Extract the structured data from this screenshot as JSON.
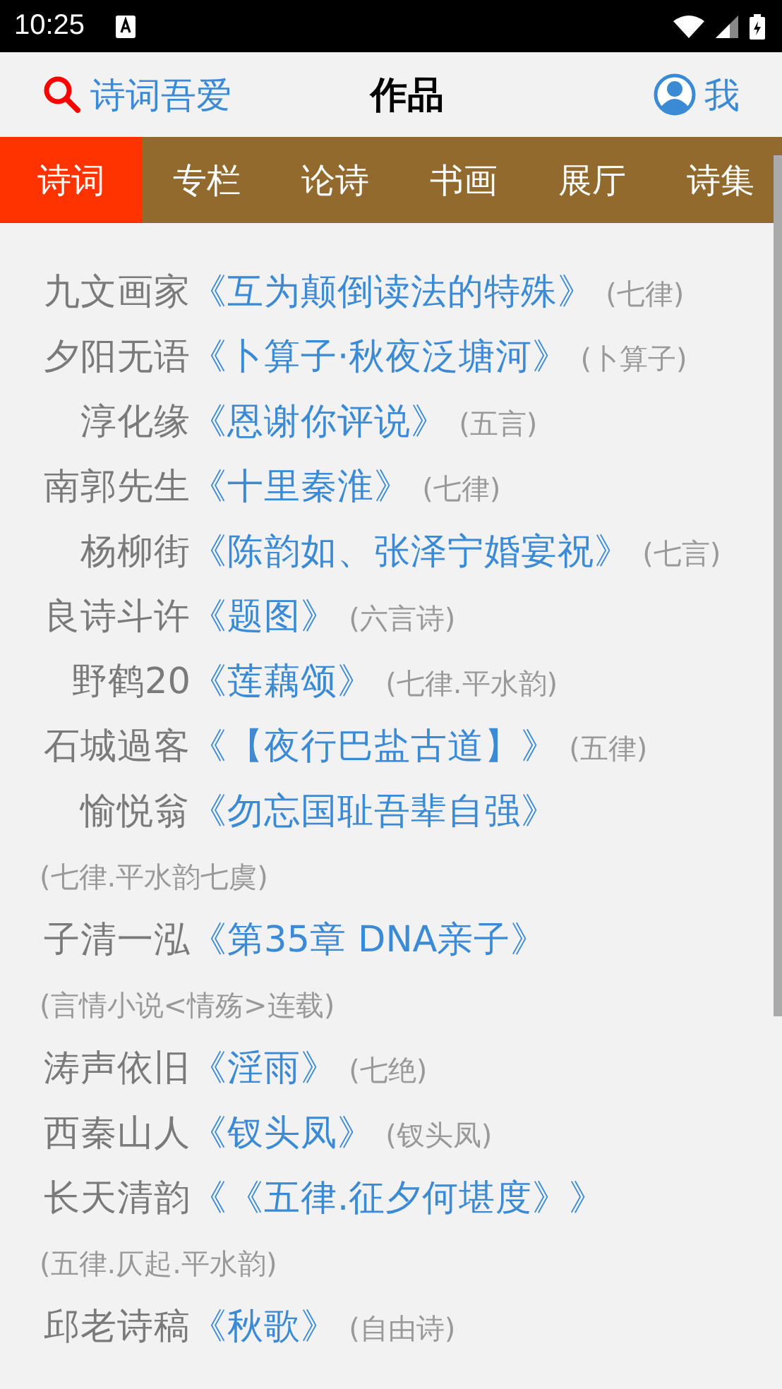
{
  "status_bar": {
    "time": "10:25"
  },
  "header": {
    "search_label": "诗词吾爱",
    "title": "作品",
    "profile_label": "我"
  },
  "tabs": [
    {
      "label": "诗词",
      "selected": true
    },
    {
      "label": "专栏",
      "selected": false
    },
    {
      "label": "论诗",
      "selected": false
    },
    {
      "label": "书画",
      "selected": false
    },
    {
      "label": "展厅",
      "selected": false
    },
    {
      "label": "诗集",
      "selected": false
    }
  ],
  "works": [
    {
      "author": "九文画家",
      "title": "《互为颠倒读法的特殊》",
      "genre": "(七律)"
    },
    {
      "author": "夕阳无语",
      "title": "《卜算子·秋夜泛塘河》",
      "genre": "(卜算子)"
    },
    {
      "author": "淳化缘",
      "title": "《恩谢你评说》",
      "genre": "(五言)"
    },
    {
      "author": "南郭先生",
      "title": "《十里秦淮》",
      "genre": "(七律)"
    },
    {
      "author": "杨柳街",
      "title": "《陈韵如、张泽宁婚宴祝》",
      "genre": "(七言)"
    },
    {
      "author": "良诗斗许",
      "title": "《题图》",
      "genre": "(六言诗)"
    },
    {
      "author": "野鹤20",
      "title": "《莲藕颂》",
      "genre": "(七律.平水韵)"
    },
    {
      "author": "石城過客",
      "title": "《【夜行巴盐古道】》",
      "genre": "(五律)"
    },
    {
      "author": "愉悦翁",
      "title": "《勿忘国耻吾辈自强》",
      "genre": "(七律.平水韵七虞)"
    },
    {
      "author": "子清一泓",
      "title": "《第35章 DNA亲子》",
      "genre": "(言情小说<情殇>连载)"
    },
    {
      "author": "涛声依旧",
      "title": "《淫雨》",
      "genre": "(七绝)"
    },
    {
      "author": "西秦山人",
      "title": "《钗头凤》",
      "genre": "(钗头凤)"
    },
    {
      "author": "长天清韵",
      "title": "《《五律.征夕何堪度》》",
      "genre": "(五律.仄起.平水韵)"
    },
    {
      "author": "邱老诗稿",
      "title": "《秋歌》",
      "genre": "(自由诗)"
    }
  ]
}
